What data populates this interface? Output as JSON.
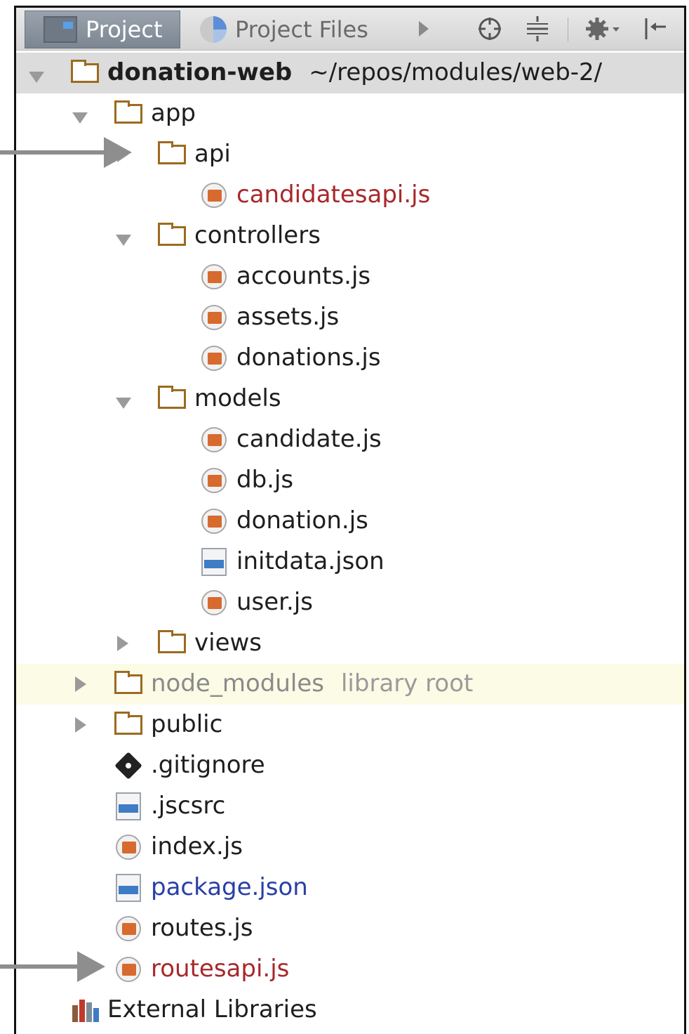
{
  "toolbar": {
    "tabs": [
      {
        "label": "Project",
        "icon": "project-icon"
      },
      {
        "label": "Project Files",
        "icon": "pie-icon"
      }
    ],
    "tools": [
      "play-arrow-icon",
      "crosshair-icon",
      "collapse-icon",
      "gear-icon",
      "hide-panel-icon"
    ]
  },
  "tree": {
    "root": {
      "name": "donation-web",
      "path": "~/repos/modules/web-2/"
    },
    "app": "app",
    "api": "api",
    "candidatesapi": "candidatesapi.js",
    "controllers": "controllers",
    "accounts": "accounts.js",
    "assets": "assets.js",
    "donations": "donations.js",
    "models": "models",
    "candidate": "candidate.js",
    "db": "db.js",
    "donation": "donation.js",
    "initdata": "initdata.json",
    "user": "user.js",
    "views": "views",
    "node_modules": {
      "name": "node_modules",
      "hint": "library root"
    },
    "public": "public",
    "gitignore": ".gitignore",
    "jscsrc": ".jscsrc",
    "index": "index.js",
    "package": "package.json",
    "routes": "routes.js",
    "routesapi": "routesapi.js",
    "external": "External Libraries"
  },
  "colors": {
    "modified_file": "#a8282a",
    "changed_file": "#2a3fa6",
    "library_hint": "#9a9a9a",
    "folder": "#9b6b1f",
    "js_badge": "#d76a2e",
    "json_badge": "#3f7cc6"
  }
}
